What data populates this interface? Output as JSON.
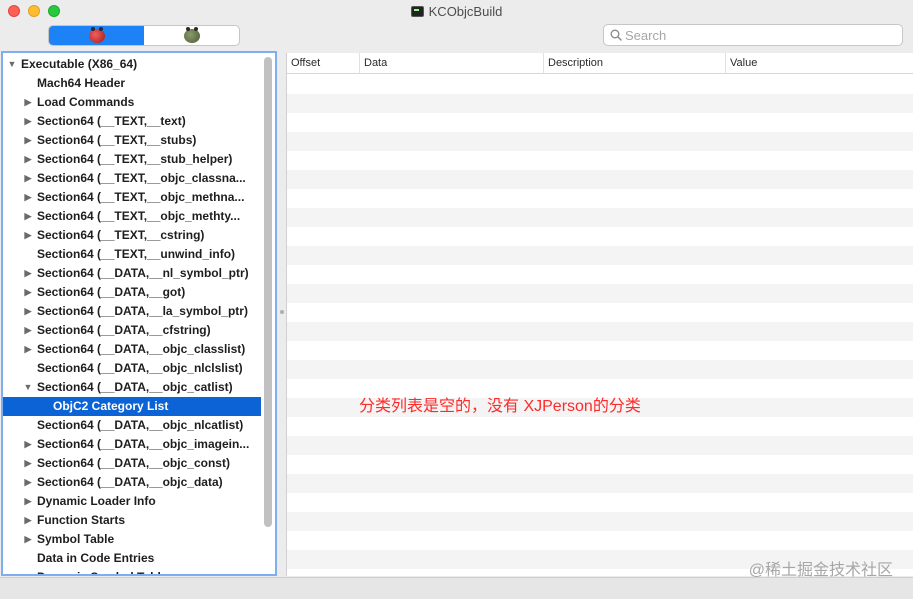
{
  "window": {
    "title": "KCObjcBuild",
    "icon": "terminal-app-icon"
  },
  "toolbar": {
    "segments": [
      {
        "icon": "red-bug-icon",
        "active": true
      },
      {
        "icon": "olive-bug-icon",
        "active": false
      }
    ],
    "search": {
      "value": "",
      "placeholder": "Search",
      "icon": "magnifier-icon"
    }
  },
  "tree": {
    "items": [
      {
        "label": "Executable  (X86_64)",
        "level": 0,
        "arrow": "expanded"
      },
      {
        "label": "Mach64 Header",
        "level": 1,
        "arrow": "none"
      },
      {
        "label": "Load Commands",
        "level": 1,
        "arrow": "collapsed"
      },
      {
        "label": "Section64 (__TEXT,__text)",
        "level": 1,
        "arrow": "collapsed"
      },
      {
        "label": "Section64 (__TEXT,__stubs)",
        "level": 1,
        "arrow": "collapsed"
      },
      {
        "label": "Section64 (__TEXT,__stub_helper)",
        "level": 1,
        "arrow": "collapsed"
      },
      {
        "label": "Section64 (__TEXT,__objc_classna...",
        "level": 1,
        "arrow": "collapsed"
      },
      {
        "label": "Section64 (__TEXT,__objc_methna...",
        "level": 1,
        "arrow": "collapsed"
      },
      {
        "label": "Section64 (__TEXT,__objc_methty...",
        "level": 1,
        "arrow": "collapsed"
      },
      {
        "label": "Section64 (__TEXT,__cstring)",
        "level": 1,
        "arrow": "collapsed"
      },
      {
        "label": "Section64 (__TEXT,__unwind_info)",
        "level": 1,
        "arrow": "none"
      },
      {
        "label": "Section64 (__DATA,__nl_symbol_ptr)",
        "level": 1,
        "arrow": "collapsed"
      },
      {
        "label": "Section64 (__DATA,__got)",
        "level": 1,
        "arrow": "collapsed"
      },
      {
        "label": "Section64 (__DATA,__la_symbol_ptr)",
        "level": 1,
        "arrow": "collapsed"
      },
      {
        "label": "Section64 (__DATA,__cfstring)",
        "level": 1,
        "arrow": "collapsed"
      },
      {
        "label": "Section64 (__DATA,__objc_classlist)",
        "level": 1,
        "arrow": "collapsed"
      },
      {
        "label": "Section64 (__DATA,__objc_nlclslist)",
        "level": 1,
        "arrow": "none"
      },
      {
        "label": "Section64 (__DATA,__objc_catlist)",
        "level": 1,
        "arrow": "expanded"
      },
      {
        "label": "ObjC2 Category List",
        "level": 2,
        "arrow": "none",
        "selected": true
      },
      {
        "label": "Section64 (__DATA,__objc_nlcatlist)",
        "level": 1,
        "arrow": "none"
      },
      {
        "label": "Section64 (__DATA,__objc_imagein...",
        "level": 1,
        "arrow": "collapsed"
      },
      {
        "label": "Section64 (__DATA,__objc_const)",
        "level": 1,
        "arrow": "collapsed"
      },
      {
        "label": "Section64 (__DATA,__objc_data)",
        "level": 1,
        "arrow": "collapsed"
      },
      {
        "label": "Dynamic Loader Info",
        "level": 1,
        "arrow": "collapsed"
      },
      {
        "label": "Function Starts",
        "level": 1,
        "arrow": "collapsed"
      },
      {
        "label": "Symbol Table",
        "level": 1,
        "arrow": "collapsed"
      },
      {
        "label": "Data in Code Entries",
        "level": 1,
        "arrow": "none"
      },
      {
        "label": "Dynamic Symbol Table",
        "level": 1,
        "arrow": "collapsed",
        "cut": true
      }
    ]
  },
  "table": {
    "columns": [
      "Offset",
      "Data",
      "Description",
      "Value"
    ],
    "rows": []
  },
  "annotation": "分类列表是空的，没有 XJPerson的分类",
  "watermark": "@稀土掘金技术社区",
  "colors": {
    "selection": "#0b63d6",
    "segment_active": "#1d82f5",
    "annotation": "#ff2a2a",
    "focus_ring": "#7faef0"
  }
}
